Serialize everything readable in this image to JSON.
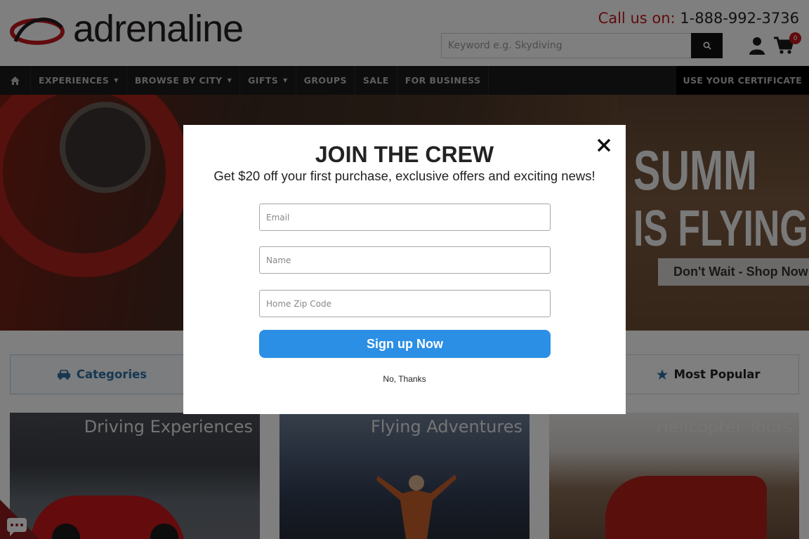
{
  "header": {
    "logo_text": "adrenaline",
    "callus_label": "Call us on:",
    "callus_number": "1-888-992-3736",
    "search_placeholder": "Keyword e.g. Skydiving",
    "cart_count": "0",
    "brand_color": "#c4161c"
  },
  "nav": {
    "items": [
      {
        "label": "EXPERIENCES",
        "has_caret": true
      },
      {
        "label": "BROWSE BY CITY",
        "has_caret": true
      },
      {
        "label": "GIFTS",
        "has_caret": true
      },
      {
        "label": "GROUPS",
        "has_caret": false
      },
      {
        "label": "SALE",
        "has_caret": false
      },
      {
        "label": "FOR BUSINESS",
        "has_caret": false
      }
    ],
    "certificate_label": "USE YOUR CERTIFICATE"
  },
  "hero": {
    "headline_line1": "SUMM",
    "headline_line2": "IS FLYING",
    "cta_label": "Don't Wait - Shop Now"
  },
  "tabs": {
    "categories_label": "Categories",
    "popular_label": "Most Popular",
    "accent_color": "#2f6ea3"
  },
  "cards": [
    {
      "title": "Driving Experiences"
    },
    {
      "title": "Flying Adventures"
    },
    {
      "title": "Helicopter Tours"
    }
  ],
  "modal": {
    "title": "JOIN THE CREW",
    "subtitle": "Get $20 off your first purchase, exclusive offers and exciting news!",
    "email_placeholder": "Email",
    "name_placeholder": "Name",
    "zip_placeholder": "Home Zip Code",
    "signup_label": "Sign up Now",
    "dismiss_label": "No, Thanks",
    "button_color": "#2b8fe5"
  },
  "icons": {
    "home": "home-icon",
    "search": "search-icon",
    "user": "user-icon",
    "cart": "cart-icon",
    "close": "close-icon",
    "car": "car-icon",
    "star": "star-icon",
    "chat": "chat-icon"
  }
}
